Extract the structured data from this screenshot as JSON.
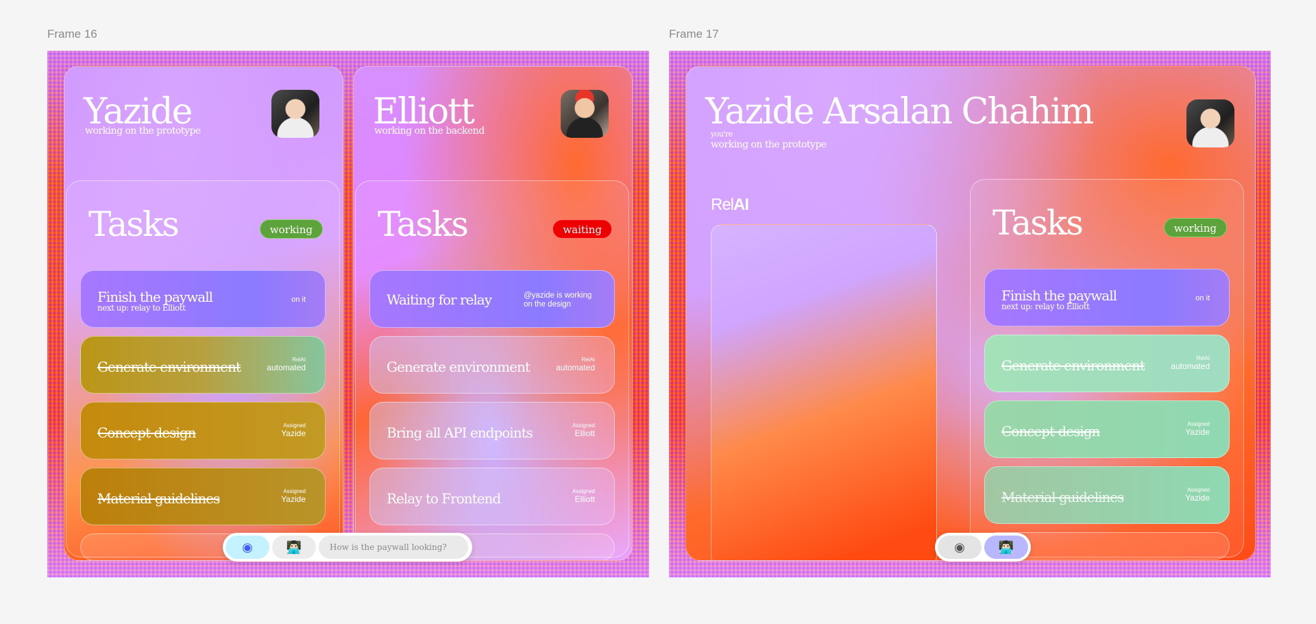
{
  "frames": {
    "f16": {
      "label": "Frame 16"
    },
    "f17": {
      "label": "Frame 17"
    }
  },
  "f16": {
    "user1": {
      "name": "Yazide",
      "status": "working on the prototype"
    },
    "user2": {
      "name": "Elliott",
      "status": "working on the backend"
    },
    "tasks1": {
      "title": "Tasks",
      "pill": "working",
      "items": [
        {
          "title": "Finish the paywall",
          "sub": "next up: relay to Elliott",
          "right": "on it"
        },
        {
          "title": "Generate environment",
          "meta_small": "RelAI",
          "meta_big": "automated"
        },
        {
          "title": "Concept design",
          "meta_small": "Assigned",
          "meta_big": "Yazide"
        },
        {
          "title": "Material guidelines",
          "meta_small": "Assigned",
          "meta_big": "Yazide"
        }
      ]
    },
    "tasks2": {
      "title": "Tasks",
      "pill": "waiting",
      "items": [
        {
          "title": "Waiting for relay",
          "right": "@yazide is working on the design"
        },
        {
          "title": "Generate environment",
          "meta_small": "RelAI",
          "meta_big": "automated"
        },
        {
          "title": "Bring all API endpoints",
          "meta_small": "Assigned",
          "meta_big": "Elliott"
        },
        {
          "title": "Relay to Frontend",
          "meta_small": "Assigned",
          "meta_big": "Elliott"
        }
      ]
    },
    "dock": {
      "placeholder": "How is the paywall looking?",
      "btn1_icon": "◉",
      "btn2_icon": "👨🏻‍💻"
    }
  },
  "f17": {
    "user": {
      "name": "Yazide Arsalan Chahim",
      "pre": "you're",
      "status": "working on the prototype"
    },
    "relai": {
      "brand_a": "Rel",
      "brand_b": "AI"
    },
    "tasks": {
      "title": "Tasks",
      "pill": "working",
      "items": [
        {
          "title": "Finish the paywall",
          "sub": "next up: relay to Elliott",
          "right": "on it"
        },
        {
          "title": "Generate environment",
          "meta_small": "RelAI",
          "meta_big": "automated"
        },
        {
          "title": "Concept design",
          "meta_small": "Assigned",
          "meta_big": "Yazide"
        },
        {
          "title": "Material guidelines",
          "meta_small": "Assigned",
          "meta_big": "Yazide"
        }
      ]
    },
    "dock": {
      "btn1_icon": "◉",
      "btn2_icon": "👨🏻‍💻"
    }
  }
}
